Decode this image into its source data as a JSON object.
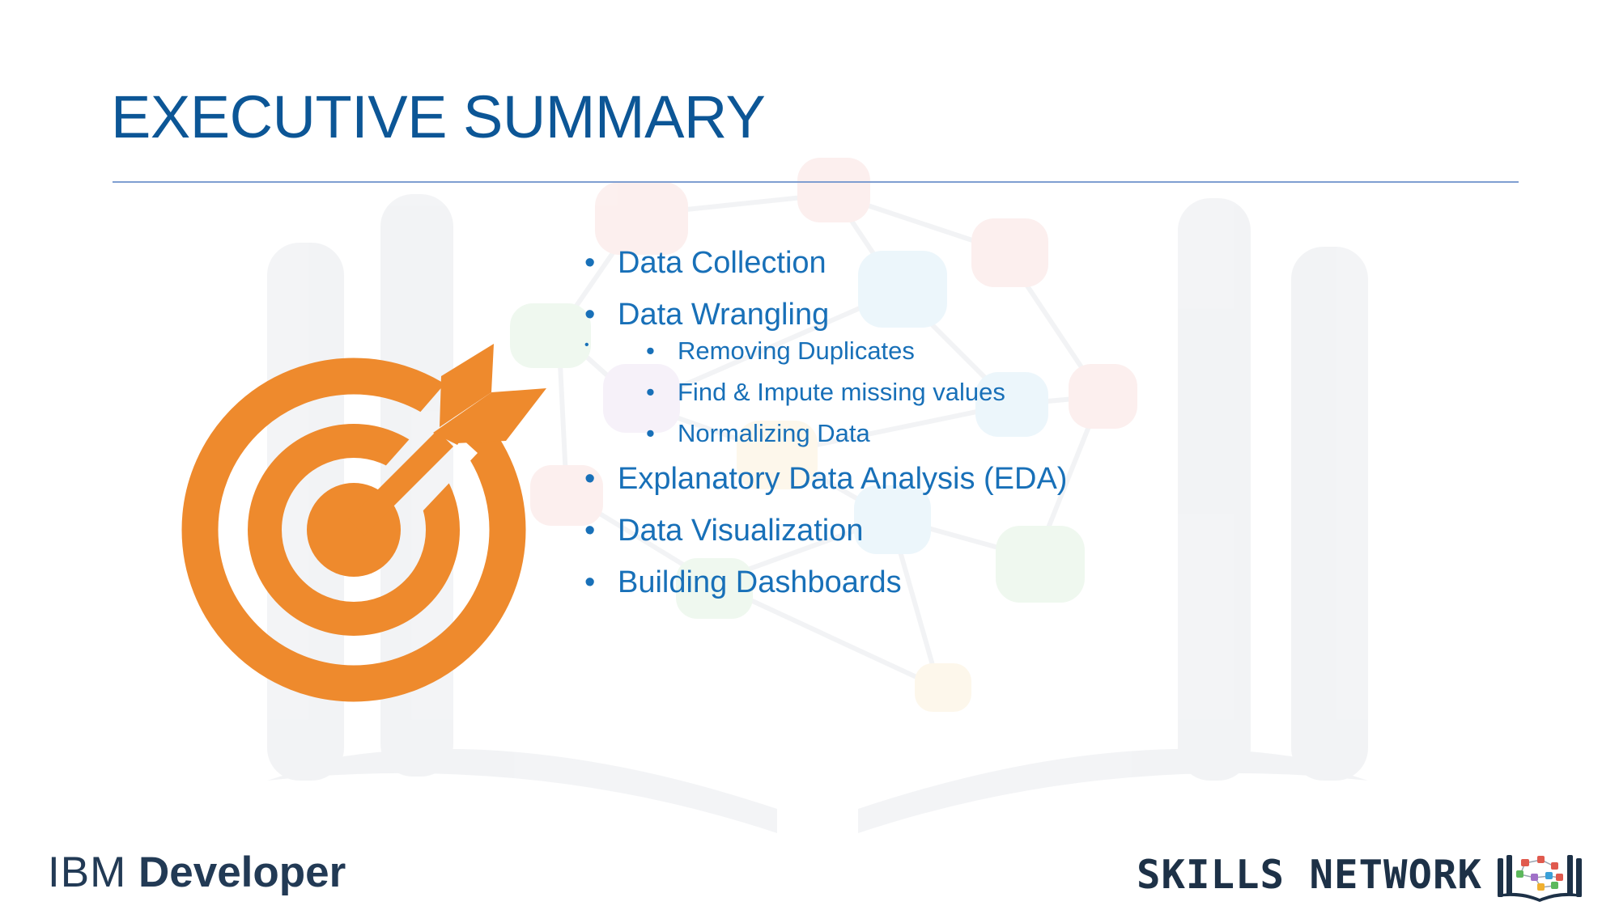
{
  "slide": {
    "title": "EXECUTIVE SUMMARY",
    "bullets": [
      {
        "text": "Data Collection"
      },
      {
        "text": "Data Wrangling",
        "children": [
          "Removing Duplicates",
          "Find & Impute missing values",
          "Normalizing Data"
        ]
      },
      {
        "text": "Explanatory Data Analysis (EDA)"
      },
      {
        "text": "Data Visualization"
      },
      {
        "text": "Building Dashboards"
      }
    ]
  },
  "footer": {
    "ibm_logo": {
      "brand": "IBM",
      "product": "Developer"
    },
    "skills_network_logo": "SKILLS NETWORK"
  },
  "icons": {
    "target": "target-with-arrow-icon",
    "book": "open-book-network-icon",
    "watermark": "open-book-network-watermark"
  },
  "colors": {
    "title": "#0c5696",
    "bullet_text": "#1870b8",
    "rule": "#7f9ed1",
    "target_orange": "#ee8a2d",
    "logo_dark": "#223a55"
  }
}
